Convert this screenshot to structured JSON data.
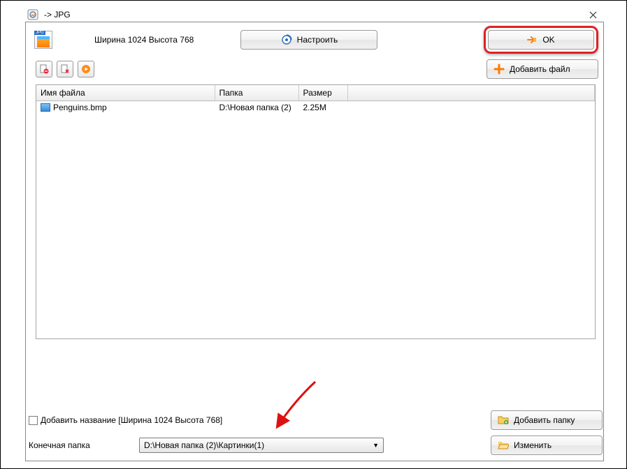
{
  "titlebar": {
    "title": "-> JPG"
  },
  "header": {
    "dimensions": "Ширина 1024 Высота 768",
    "configure": "Настроить",
    "ok": "OK",
    "add_file": "Добавить файл"
  },
  "table": {
    "columns": {
      "name": "Имя файла",
      "folder": "Папка",
      "size": "Размер"
    },
    "rows": [
      {
        "name": "Penguins.bmp",
        "folder": "D:\\Новая папка (2)",
        "size": "2.25M"
      }
    ]
  },
  "footer": {
    "add_title_label": "Добавить название [Ширина 1024 Высота 768]",
    "dest_label": "Конечная папка",
    "dest_value": "D:\\Новая папка (2)\\Картинки(1)",
    "add_folder": "Добавить папку",
    "change": "Изменить"
  }
}
